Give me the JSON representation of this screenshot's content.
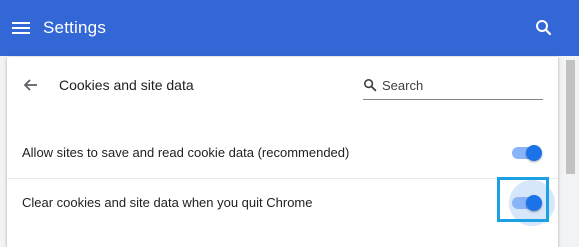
{
  "app_bar": {
    "title": "Settings",
    "background_color": "#3367d6",
    "menu_icon": "hamburger-menu-icon",
    "search_icon": "search-icon"
  },
  "subpage": {
    "title": "Cookies and site data",
    "back_icon": "arrow-back-icon",
    "search": {
      "placeholder": "Search",
      "value": ""
    }
  },
  "settings": [
    {
      "label": "Allow sites to save and read cookie data (recommended)",
      "enabled": true
    },
    {
      "label": "Clear cookies and site data when you quit Chrome",
      "enabled": true,
      "highlighted": true
    }
  ],
  "colors": {
    "toggle_knob": "#1a73e8",
    "toggle_track": "#8ab4f8",
    "highlight_border": "#1ba1e2"
  }
}
